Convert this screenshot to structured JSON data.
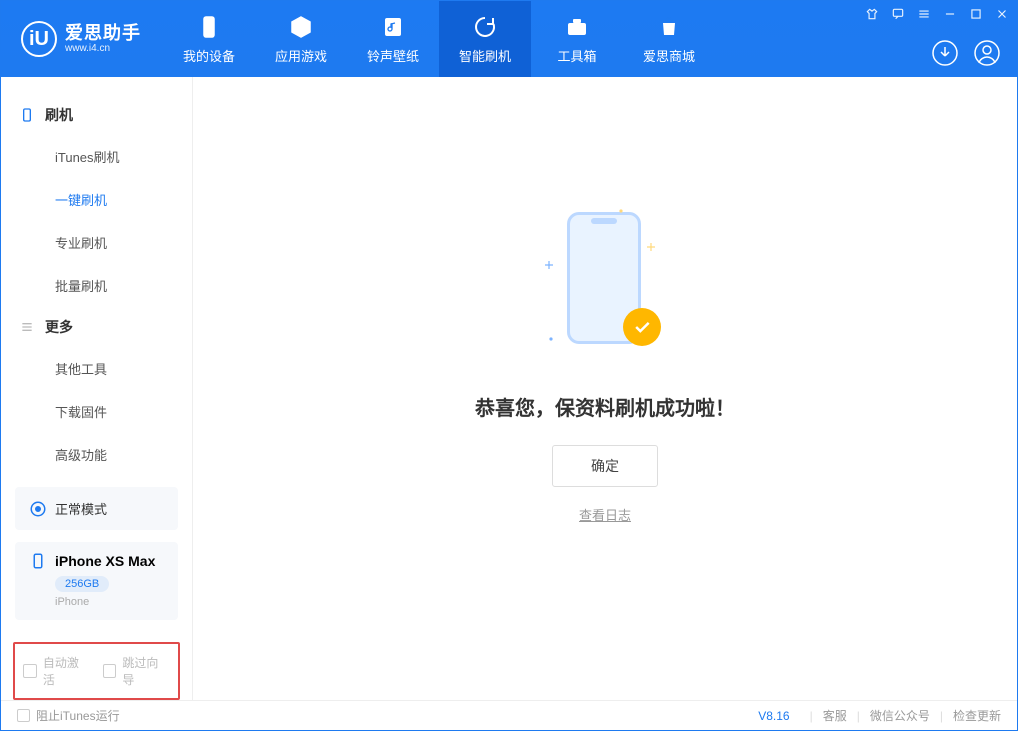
{
  "brand": {
    "name": "爱思助手",
    "url": "www.i4.cn",
    "logo_letter": "iU"
  },
  "nav": {
    "tabs": [
      {
        "label": "我的设备",
        "icon": "device"
      },
      {
        "label": "应用游戏",
        "icon": "cube"
      },
      {
        "label": "铃声壁纸",
        "icon": "music"
      },
      {
        "label": "智能刷机",
        "icon": "refresh",
        "active": true
      },
      {
        "label": "工具箱",
        "icon": "toolbox"
      },
      {
        "label": "爱思商城",
        "icon": "bag"
      }
    ]
  },
  "sidebar": {
    "group1": {
      "title": "刷机",
      "items": [
        "iTunes刷机",
        "一键刷机",
        "专业刷机",
        "批量刷机"
      ],
      "active_index": 1
    },
    "group2": {
      "title": "更多",
      "items": [
        "其他工具",
        "下载固件",
        "高级功能"
      ]
    },
    "mode_card": {
      "label": "正常模式"
    },
    "device": {
      "name": "iPhone XS Max",
      "storage": "256GB",
      "type": "iPhone"
    },
    "checkboxes": {
      "auto_activate": "自动激活",
      "skip_guide": "跳过向导"
    }
  },
  "main": {
    "success_text": "恭喜您，保资料刷机成功啦！",
    "confirm_label": "确定",
    "log_link": "查看日志"
  },
  "statusbar": {
    "block_itunes": "阻止iTunes运行",
    "version": "V8.16",
    "links": [
      "客服",
      "微信公众号",
      "检查更新"
    ]
  }
}
